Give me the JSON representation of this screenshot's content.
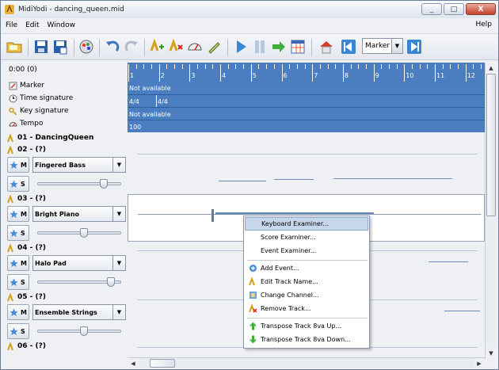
{
  "window": {
    "title": "MidiYodi - dancing_queen.mid",
    "minimize": "_",
    "maximize": "□",
    "close": "X"
  },
  "menubar": {
    "items": [
      "File",
      "Edit",
      "Window"
    ],
    "help": "Help"
  },
  "toolbar": {
    "marker_select": "Marker",
    "marker_arrow": "▼"
  },
  "timeline": {
    "position": "0:00 (0)",
    "ticks": [
      "1",
      "2",
      "3",
      "4",
      "5",
      "6",
      "7",
      "8",
      "9",
      "10",
      "11",
      "12"
    ]
  },
  "meta_rows": [
    {
      "label": "Marker",
      "value": "Not available"
    },
    {
      "label": "Time signature",
      "values": [
        "4/4",
        "4/4"
      ]
    },
    {
      "label": "Key signature",
      "value": "Not available"
    },
    {
      "label": "Tempo",
      "value": "100"
    }
  ],
  "tracks": [
    {
      "name": "01 - DancingQueen"
    },
    {
      "name": "02 - (?)",
      "instrument": "Fingered Bass",
      "m": "M",
      "s": "S",
      "volume": 0.75
    },
    {
      "name": "03 - (?)",
      "instrument": "Bright Piano",
      "m": "M",
      "s": "S",
      "volume": 0.5
    },
    {
      "name": "04 - (?)",
      "instrument": "Halo Pad",
      "m": "M",
      "s": "S",
      "volume": 0.82
    },
    {
      "name": "05 - (?)",
      "instrument": "Ensemble Strings",
      "m": "M",
      "s": "S",
      "volume": 0.5
    },
    {
      "name": "06 - (?)"
    }
  ],
  "context_menu": {
    "items": [
      "Keyboard Examiner...",
      "Score Examiner...",
      "Event Examiner...",
      "Add Event...",
      "Edit Track Name...",
      "Change Channel...",
      "Remove Track...",
      "Transpose Track 8va Up...",
      "Transpose Track 8va Down..."
    ]
  },
  "colors": {
    "accent": "#4b7ec0",
    "highlight": "#c6d6ec"
  }
}
